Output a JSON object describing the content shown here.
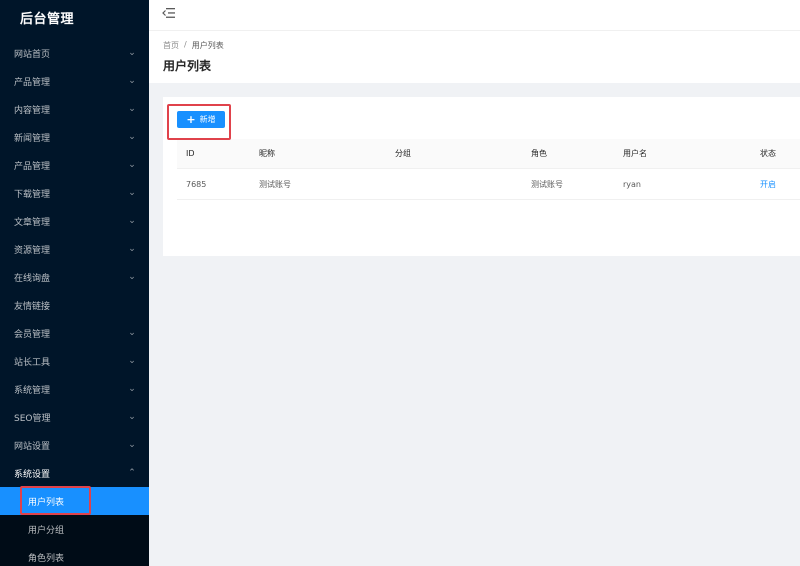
{
  "app": {
    "title": "后台管理"
  },
  "sidebar": {
    "items": [
      {
        "label": "网站首页"
      },
      {
        "label": "产品管理"
      },
      {
        "label": "内容管理"
      },
      {
        "label": "新闻管理"
      },
      {
        "label": "产品管理"
      },
      {
        "label": "下载管理"
      },
      {
        "label": "文章管理"
      },
      {
        "label": "资源管理"
      },
      {
        "label": "在线询盘"
      },
      {
        "label": "友情链接"
      },
      {
        "label": "会员管理"
      },
      {
        "label": "站长工具"
      },
      {
        "label": "系统管理"
      },
      {
        "label": "SEO管理"
      },
      {
        "label": "网站设置"
      },
      {
        "label": "系统设置"
      }
    ],
    "submenu": [
      {
        "label": "用户列表"
      },
      {
        "label": "用户分组"
      },
      {
        "label": "角色列表"
      }
    ]
  },
  "breadcrumb": {
    "home": "首页",
    "separator": "/",
    "current": "用户列表"
  },
  "page": {
    "title": "用户列表"
  },
  "toolbar": {
    "add_label": "新增"
  },
  "table": {
    "headers": [
      "ID",
      "昵称",
      "分组",
      "角色",
      "用户名",
      "状态"
    ],
    "rows": [
      {
        "id": "7685",
        "nickname": "测试账号",
        "group": "",
        "role": "测试账号",
        "username": "ryan",
        "status": "开启"
      }
    ]
  },
  "colors": {
    "sidebar_bg": "#001529",
    "accent": "#1890ff",
    "highlight": "#e0424b"
  }
}
